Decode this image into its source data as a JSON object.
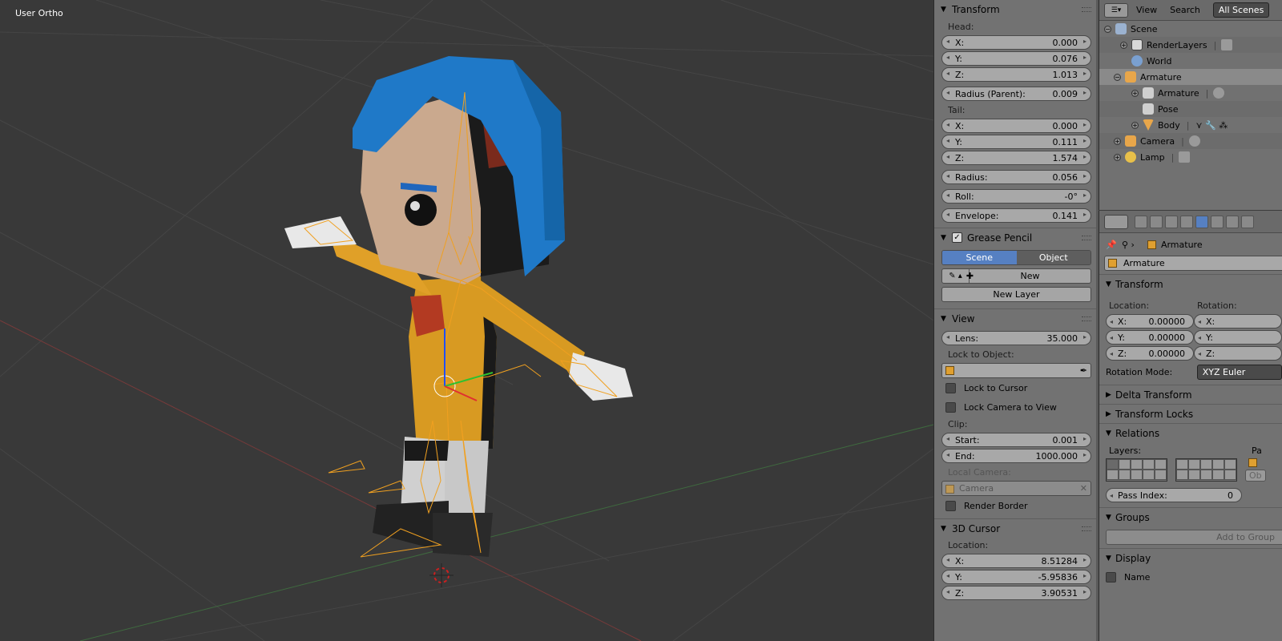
{
  "viewport": {
    "label": "User Ortho"
  },
  "npanel": {
    "transform": {
      "title": "Transform",
      "head_label": "Head:",
      "head": [
        {
          "axis": "X:",
          "value": "0.000"
        },
        {
          "axis": "Y:",
          "value": "0.076"
        },
        {
          "axis": "Z:",
          "value": "1.013"
        }
      ],
      "radius_parent": {
        "label": "Radius (Parent):",
        "value": "0.009"
      },
      "tail_label": "Tail:",
      "tail": [
        {
          "axis": "X:",
          "value": "0.000"
        },
        {
          "axis": "Y:",
          "value": "0.111"
        },
        {
          "axis": "Z:",
          "value": "1.574"
        }
      ],
      "radius": {
        "label": "Radius:",
        "value": "0.056"
      },
      "roll": {
        "label": "Roll:",
        "value": "-0°"
      },
      "envelope": {
        "label": "Envelope:",
        "value": "0.141"
      }
    },
    "grease_pencil": {
      "title": "Grease Pencil",
      "tab_scene": "Scene",
      "tab_object": "Object",
      "new_label": "New",
      "new_layer_label": "New Layer"
    },
    "view": {
      "title": "View",
      "lens": {
        "label": "Lens:",
        "value": "35.000"
      },
      "lock_to_object_label": "Lock to Object:",
      "lock_to_cursor": "Lock to Cursor",
      "lock_camera_to_view": "Lock Camera to View",
      "clip_label": "Clip:",
      "clip_start": {
        "label": "Start:",
        "value": "0.001"
      },
      "clip_end": {
        "label": "End:",
        "value": "1000.000"
      },
      "local_camera_label": "Local Camera:",
      "local_camera_value": "Camera",
      "render_border": "Render Border"
    },
    "cursor": {
      "title": "3D Cursor",
      "location_label": "Location:",
      "location": [
        {
          "axis": "X:",
          "value": "8.51284"
        },
        {
          "axis": "Y:",
          "value": "-5.95836"
        },
        {
          "axis": "Z:",
          "value": "3.90531"
        }
      ]
    }
  },
  "outliner": {
    "menu_view": "View",
    "menu_search": "Search",
    "scene_select": "All Scenes",
    "rows": [
      {
        "name": "Scene",
        "indent": 0,
        "icon": "scene",
        "exp": "−"
      },
      {
        "name": "RenderLayers",
        "indent": 1,
        "icon": "rl",
        "exp": "+"
      },
      {
        "name": "World",
        "indent": 1,
        "icon": "world",
        "exp": ""
      },
      {
        "name": "Armature",
        "indent": 1,
        "icon": "arm",
        "exp": "−",
        "highlight": true
      },
      {
        "name": "Armature",
        "indent": 2,
        "icon": "arm2",
        "exp": "+"
      },
      {
        "name": "Pose",
        "indent": 2,
        "icon": "pose",
        "exp": ""
      },
      {
        "name": "Body",
        "indent": 2,
        "icon": "mesh",
        "exp": "+"
      },
      {
        "name": "Camera",
        "indent": 1,
        "icon": "cam",
        "exp": "+"
      },
      {
        "name": "Lamp",
        "indent": 1,
        "icon": "lamp",
        "exp": "+"
      }
    ]
  },
  "properties": {
    "breadcrumb": "Armature",
    "object_name": "Armature",
    "transform_title": "Transform",
    "location_label": "Location:",
    "rotation_label": "Rotation:",
    "location": [
      {
        "axis": "X:",
        "value": "0.00000"
      },
      {
        "axis": "Y:",
        "value": "0.00000"
      },
      {
        "axis": "Z:",
        "value": "0.00000"
      }
    ],
    "rotation": [
      {
        "axis": "X:"
      },
      {
        "axis": "Y:"
      },
      {
        "axis": "Z:"
      }
    ],
    "rotation_mode_label": "Rotation Mode:",
    "rotation_mode": "XYZ Euler",
    "delta_transform": "Delta Transform",
    "transform_locks": "Transform Locks",
    "relations": "Relations",
    "layers_label": "Layers:",
    "pa_label": "Pa",
    "ob_label": "Ob",
    "pass_index": {
      "label": "Pass Index:",
      "value": "0"
    },
    "groups": "Groups",
    "add_to_group": "Add to Group",
    "display": "Display",
    "name_option": "Name"
  },
  "colors": {
    "accent": "#5680c2",
    "bone": "#f0a020",
    "grid": "#4a4a4a"
  }
}
